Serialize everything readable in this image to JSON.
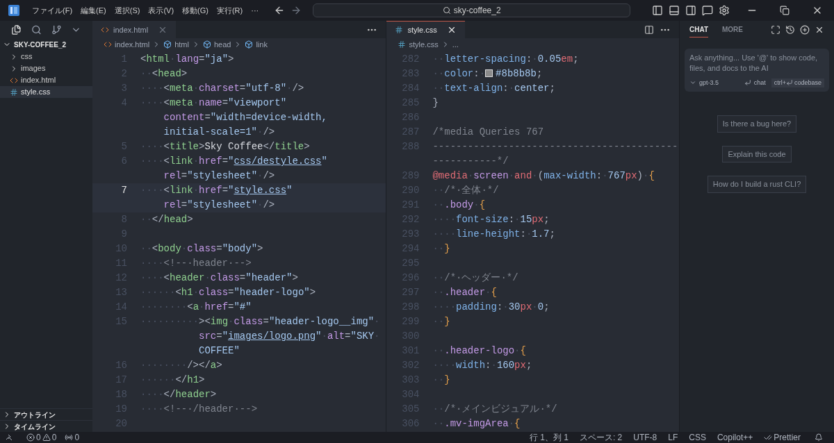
{
  "menu": [
    "ファイル(F)",
    "編集(E)",
    "選択(S)",
    "表示(V)",
    "移動(G)",
    "実行(R)",
    "···"
  ],
  "search": {
    "value": "sky-coffee_2"
  },
  "explorer": {
    "title": "SKY-COFFEE_2",
    "expanded": true,
    "items": [
      {
        "label": "css",
        "kind": "folder",
        "expanded": false,
        "selected": false
      },
      {
        "label": "images",
        "kind": "folder",
        "expanded": false,
        "selected": false
      },
      {
        "label": "index.html",
        "kind": "html",
        "selected": false
      },
      {
        "label": "style.css",
        "kind": "css",
        "selected": true
      }
    ],
    "sections": [
      {
        "label": "アウトライン",
        "expanded": false
      },
      {
        "label": "タイムライン",
        "expanded": false
      }
    ]
  },
  "editors": [
    {
      "focused": false,
      "tab": {
        "label": "index.html",
        "kind": "html"
      },
      "breadcrumb": [
        {
          "kind": "html",
          "text": "index.html"
        },
        {
          "kind": "symbol",
          "text": "html"
        },
        {
          "kind": "symbol",
          "text": "head"
        },
        {
          "kind": "symbol",
          "text": "link"
        }
      ],
      "lines": [
        {
          "number": "1",
          "tokens": [
            {
              "kind": "p",
              "text": "<"
            },
            {
              "kind": "tag",
              "text": "html"
            },
            {
              "kind": "ws",
              "text": "·"
            },
            {
              "kind": "attr",
              "text": "lang"
            },
            {
              "kind": "p",
              "text": "="
            },
            {
              "kind": "str",
              "text": "\"ja\""
            },
            {
              "kind": "p",
              "text": ">"
            }
          ]
        },
        {
          "number": "2",
          "tokens": [
            {
              "kind": "ws",
              "text": "··"
            },
            {
              "kind": "p",
              "text": "<"
            },
            {
              "kind": "tag",
              "text": "head"
            },
            {
              "kind": "p",
              "text": ">"
            }
          ]
        },
        {
          "number": "3",
          "tokens": [
            {
              "kind": "ws",
              "text": "····"
            },
            {
              "kind": "p",
              "text": "<"
            },
            {
              "kind": "tag",
              "text": "meta"
            },
            {
              "kind": "ws",
              "text": "·"
            },
            {
              "kind": "attr",
              "text": "charset"
            },
            {
              "kind": "p",
              "text": "="
            },
            {
              "kind": "str",
              "text": "\"utf-8\""
            },
            {
              "kind": "ws",
              "text": "·"
            },
            {
              "kind": "p",
              "text": "/>"
            }
          ]
        },
        {
          "number": "4",
          "tokens": [
            {
              "kind": "ws",
              "text": "····"
            },
            {
              "kind": "p",
              "text": "<"
            },
            {
              "kind": "tag",
              "text": "meta"
            },
            {
              "kind": "ws",
              "text": "·"
            },
            {
              "kind": "attr",
              "text": "name"
            },
            {
              "kind": "p",
              "text": "="
            },
            {
              "kind": "str",
              "text": "\"viewport\""
            }
          ],
          "wrapped": [
            [
              {
                "kind": "attr",
                "text": "content"
              },
              {
                "kind": "p",
                "text": "="
              },
              {
                "kind": "str",
                "text": "\"width=device-width,"
              }
            ],
            [
              {
                "kind": "str",
                "text": "initial-scale=1\""
              },
              {
                "kind": "ws",
                "text": "·"
              },
              {
                "kind": "p",
                "text": "/>"
              }
            ]
          ]
        },
        {
          "number": "5",
          "tokens": [
            {
              "kind": "ws",
              "text": "····"
            },
            {
              "kind": "p",
              "text": "<"
            },
            {
              "kind": "tag",
              "text": "title"
            },
            {
              "kind": "p",
              "text": ">"
            },
            {
              "kind": "text",
              "text": "Sky Coffee"
            },
            {
              "kind": "p",
              "text": "</"
            },
            {
              "kind": "tag",
              "text": "title"
            },
            {
              "kind": "p",
              "text": ">"
            }
          ]
        },
        {
          "number": "6",
          "tokens": [
            {
              "kind": "ws",
              "text": "····"
            },
            {
              "kind": "p",
              "text": "<"
            },
            {
              "kind": "tag",
              "text": "link"
            },
            {
              "kind": "ws",
              "text": "·"
            },
            {
              "kind": "attr",
              "text": "href"
            },
            {
              "kind": "p",
              "text": "="
            },
            {
              "kind": "str",
              "text": "\""
            },
            {
              "kind": "link",
              "text": "css/destyle.css"
            },
            {
              "kind": "str",
              "text": "\""
            }
          ],
          "wrapped": [
            [
              {
                "kind": "attr",
                "text": "rel"
              },
              {
                "kind": "p",
                "text": "="
              },
              {
                "kind": "str",
                "text": "\"stylesheet\""
              },
              {
                "kind": "ws",
                "text": "·"
              },
              {
                "kind": "p",
                "text": "/>"
              }
            ]
          ]
        },
        {
          "number": "7",
          "current": true,
          "tokens": [
            {
              "kind": "ws",
              "text": "····"
            },
            {
              "kind": "p",
              "text": "<"
            },
            {
              "kind": "tag",
              "text": "link"
            },
            {
              "kind": "ws",
              "text": "·"
            },
            {
              "kind": "attr",
              "text": "href"
            },
            {
              "kind": "p",
              "text": "="
            },
            {
              "kind": "str",
              "text": "\""
            },
            {
              "kind": "link",
              "text": "style.css"
            },
            {
              "kind": "str",
              "text": "\""
            }
          ],
          "wrapped": [
            [
              {
                "kind": "attr",
                "text": "rel"
              },
              {
                "kind": "p",
                "text": "="
              },
              {
                "kind": "str",
                "text": "\"stylesheet\""
              },
              {
                "kind": "ws",
                "text": "·"
              },
              {
                "kind": "p",
                "text": "/>"
              }
            ]
          ]
        },
        {
          "number": "8",
          "tokens": [
            {
              "kind": "ws",
              "text": "··"
            },
            {
              "kind": "p",
              "text": "</"
            },
            {
              "kind": "tag",
              "text": "head"
            },
            {
              "kind": "p",
              "text": ">"
            }
          ]
        },
        {
          "number": "9"
        },
        {
          "number": "10",
          "tokens": [
            {
              "kind": "ws",
              "text": "··"
            },
            {
              "kind": "p",
              "text": "<"
            },
            {
              "kind": "tag",
              "text": "body"
            },
            {
              "kind": "ws",
              "text": "·"
            },
            {
              "kind": "attr",
              "text": "class"
            },
            {
              "kind": "p",
              "text": "="
            },
            {
              "kind": "str",
              "text": "\"body\""
            },
            {
              "kind": "p",
              "text": ">"
            }
          ]
        },
        {
          "number": "11",
          "tokens": [
            {
              "kind": "ws",
              "text": "····"
            },
            {
              "kind": "com",
              "text": "<!--·header·-->"
            }
          ]
        },
        {
          "number": "12",
          "tokens": [
            {
              "kind": "ws",
              "text": "····"
            },
            {
              "kind": "p",
              "text": "<"
            },
            {
              "kind": "tag",
              "text": "header"
            },
            {
              "kind": "ws",
              "text": "·"
            },
            {
              "kind": "attr",
              "text": "class"
            },
            {
              "kind": "p",
              "text": "="
            },
            {
              "kind": "str",
              "text": "\"header\""
            },
            {
              "kind": "p",
              "text": ">"
            }
          ]
        },
        {
          "number": "13",
          "tokens": [
            {
              "kind": "ws",
              "text": "······"
            },
            {
              "kind": "p",
              "text": "<"
            },
            {
              "kind": "tag",
              "text": "h1"
            },
            {
              "kind": "ws",
              "text": "·"
            },
            {
              "kind": "attr",
              "text": "class"
            },
            {
              "kind": "p",
              "text": "="
            },
            {
              "kind": "str",
              "text": "\"header-logo\""
            },
            {
              "kind": "p",
              "text": ">"
            }
          ]
        },
        {
          "number": "14",
          "tokens": [
            {
              "kind": "ws",
              "text": "········"
            },
            {
              "kind": "p",
              "text": "<"
            },
            {
              "kind": "tag",
              "text": "a"
            },
            {
              "kind": "ws",
              "text": "·"
            },
            {
              "kind": "attr",
              "text": "href"
            },
            {
              "kind": "p",
              "text": "="
            },
            {
              "kind": "str",
              "text": "\"#\""
            }
          ]
        },
        {
          "number": "15",
          "tokens": [
            {
              "kind": "ws",
              "text": "··········"
            },
            {
              "kind": "p",
              "text": "><"
            },
            {
              "kind": "tag",
              "text": "img"
            },
            {
              "kind": "ws",
              "text": "·"
            },
            {
              "kind": "attr",
              "text": "class"
            },
            {
              "kind": "p",
              "text": "="
            },
            {
              "kind": "str",
              "text": "\"header-logo__img\""
            },
            {
              "kind": "ws",
              "text": "·"
            }
          ],
          "wrapped": [
            [
              {
                "kind": "attr",
                "text": "src"
              },
              {
                "kind": "p",
                "text": "="
              },
              {
                "kind": "str",
                "text": "\""
              },
              {
                "kind": "link",
                "text": "images/logo.png"
              },
              {
                "kind": "str",
                "text": "\""
              },
              {
                "kind": "ws",
                "text": "·"
              },
              {
                "kind": "attr",
                "text": "alt"
              },
              {
                "kind": "p",
                "text": "="
              },
              {
                "kind": "str",
                "text": "\"SKY"
              },
              {
                "kind": "ws",
                "text": "·"
              }
            ],
            [
              {
                "kind": "str",
                "text": "COFFEE\""
              }
            ]
          ]
        },
        {
          "number": "16",
          "tokens": [
            {
              "kind": "ws",
              "text": "········"
            },
            {
              "kind": "p",
              "text": "/></"
            },
            {
              "kind": "tag",
              "text": "a"
            },
            {
              "kind": "p",
              "text": ">"
            }
          ]
        },
        {
          "number": "17",
          "tokens": [
            {
              "kind": "ws",
              "text": "······"
            },
            {
              "kind": "p",
              "text": "</"
            },
            {
              "kind": "tag",
              "text": "h1"
            },
            {
              "kind": "p",
              "text": ">"
            }
          ]
        },
        {
          "number": "18",
          "tokens": [
            {
              "kind": "ws",
              "text": "····"
            },
            {
              "kind": "p",
              "text": "</"
            },
            {
              "kind": "tag",
              "text": "header"
            },
            {
              "kind": "p",
              "text": ">"
            }
          ]
        },
        {
          "number": "19",
          "tokens": [
            {
              "kind": "ws",
              "text": "····"
            },
            {
              "kind": "com",
              "text": "<!--·/header·-->"
            }
          ]
        },
        {
          "number": "20"
        }
      ]
    },
    {
      "focused": true,
      "tab": {
        "label": "style.css",
        "kind": "css"
      },
      "breadcrumb": [
        {
          "kind": "css",
          "text": "style.css"
        },
        {
          "kind": "more",
          "text": "..."
        }
      ],
      "lines": [
        {
          "number": "282",
          "tokens": [
            {
              "kind": "ws",
              "text": "··"
            },
            {
              "kind": "prop",
              "text": "letter-spacing"
            },
            {
              "kind": "p",
              "text": ":"
            },
            {
              "kind": "ws",
              "text": "·"
            },
            {
              "kind": "num",
              "text": "0.05"
            },
            {
              "kind": "unit",
              "text": "em"
            },
            {
              "kind": "p",
              "text": ";"
            }
          ]
        },
        {
          "number": "283",
          "tokens": [
            {
              "kind": "ws",
              "text": "··"
            },
            {
              "kind": "prop",
              "text": "color"
            },
            {
              "kind": "p",
              "text": ":"
            },
            {
              "kind": "ws",
              "text": "·"
            },
            {
              "kind": "swatch",
              "color": "#8b8b8b"
            },
            {
              "kind": "num",
              "text": "#8b8b8b"
            },
            {
              "kind": "p",
              "text": ";"
            }
          ]
        },
        {
          "number": "284",
          "tokens": [
            {
              "kind": "ws",
              "text": "··"
            },
            {
              "kind": "prop",
              "text": "text-align"
            },
            {
              "kind": "p",
              "text": ":"
            },
            {
              "kind": "ws",
              "text": "·"
            },
            {
              "kind": "num",
              "text": "center"
            },
            {
              "kind": "p",
              "text": ";"
            }
          ]
        },
        {
          "number": "285",
          "tokens": [
            {
              "kind": "p",
              "text": "}"
            }
          ]
        },
        {
          "number": "286"
        },
        {
          "number": "287",
          "tokens": [
            {
              "kind": "com",
              "text": "/*media Queries 767"
            }
          ]
        },
        {
          "number": "288",
          "tokens": [
            {
              "kind": "com",
              "text": "------------------------------------------"
            }
          ],
          "wrapped": [
            [
              {
                "kind": "com",
                "text": "-----------*/"
              }
            ]
          ]
        },
        {
          "number": "289",
          "tokens": [
            {
              "kind": "at",
              "text": "@media"
            },
            {
              "kind": "ws",
              "text": "·"
            },
            {
              "kind": "sel",
              "text": "screen"
            },
            {
              "kind": "ws",
              "text": "·"
            },
            {
              "kind": "at",
              "text": "and"
            },
            {
              "kind": "ws",
              "text": "·"
            },
            {
              "kind": "p",
              "text": "("
            },
            {
              "kind": "prop",
              "text": "max-width"
            },
            {
              "kind": "p",
              "text": ":"
            },
            {
              "kind": "ws",
              "text": "·"
            },
            {
              "kind": "num",
              "text": "767"
            },
            {
              "kind": "unit",
              "text": "px"
            },
            {
              "kind": "p",
              "text": ")"
            },
            {
              "kind": "ws",
              "text": "·"
            },
            {
              "kind": "brace",
              "text": "{"
            }
          ]
        },
        {
          "number": "290",
          "tokens": [
            {
              "kind": "ws",
              "text": "··"
            },
            {
              "kind": "com",
              "text": "/*·全体·*/"
            }
          ]
        },
        {
          "number": "291",
          "tokens": [
            {
              "kind": "ws",
              "text": "··"
            },
            {
              "kind": "sel",
              "text": ".body"
            },
            {
              "kind": "ws",
              "text": "·"
            },
            {
              "kind": "brace",
              "text": "{"
            }
          ]
        },
        {
          "number": "292",
          "tokens": [
            {
              "kind": "ws",
              "text": "····"
            },
            {
              "kind": "prop",
              "text": "font-size"
            },
            {
              "kind": "p",
              "text": ":"
            },
            {
              "kind": "ws",
              "text": "·"
            },
            {
              "kind": "num",
              "text": "15"
            },
            {
              "kind": "unit",
              "text": "px"
            },
            {
              "kind": "p",
              "text": ";"
            }
          ]
        },
        {
          "number": "293",
          "tokens": [
            {
              "kind": "ws",
              "text": "····"
            },
            {
              "kind": "prop",
              "text": "line-height"
            },
            {
              "kind": "p",
              "text": ":"
            },
            {
              "kind": "ws",
              "text": "·"
            },
            {
              "kind": "num",
              "text": "1.7"
            },
            {
              "kind": "p",
              "text": ";"
            }
          ]
        },
        {
          "number": "294",
          "tokens": [
            {
              "kind": "ws",
              "text": "··"
            },
            {
              "kind": "brace",
              "text": "}"
            }
          ]
        },
        {
          "number": "295"
        },
        {
          "number": "296",
          "tokens": [
            {
              "kind": "ws",
              "text": "··"
            },
            {
              "kind": "com",
              "text": "/*·ヘッダー·*/"
            }
          ]
        },
        {
          "number": "297",
          "tokens": [
            {
              "kind": "ws",
              "text": "··"
            },
            {
              "kind": "sel",
              "text": ".header"
            },
            {
              "kind": "ws",
              "text": "·"
            },
            {
              "kind": "brace",
              "text": "{"
            }
          ]
        },
        {
          "number": "298",
          "tokens": [
            {
              "kind": "ws",
              "text": "····"
            },
            {
              "kind": "prop",
              "text": "padding"
            },
            {
              "kind": "p",
              "text": ":"
            },
            {
              "kind": "ws",
              "text": "·"
            },
            {
              "kind": "num",
              "text": "30"
            },
            {
              "kind": "unit",
              "text": "px"
            },
            {
              "kind": "ws",
              "text": "·"
            },
            {
              "kind": "num",
              "text": "0"
            },
            {
              "kind": "p",
              "text": ";"
            }
          ]
        },
        {
          "number": "299",
          "tokens": [
            {
              "kind": "ws",
              "text": "··"
            },
            {
              "kind": "brace",
              "text": "}"
            }
          ]
        },
        {
          "number": "300"
        },
        {
          "number": "301",
          "tokens": [
            {
              "kind": "ws",
              "text": "··"
            },
            {
              "kind": "sel",
              "text": ".header-logo"
            },
            {
              "kind": "ws",
              "text": "·"
            },
            {
              "kind": "brace",
              "text": "{"
            }
          ]
        },
        {
          "number": "302",
          "tokens": [
            {
              "kind": "ws",
              "text": "····"
            },
            {
              "kind": "prop",
              "text": "width"
            },
            {
              "kind": "p",
              "text": ":"
            },
            {
              "kind": "ws",
              "text": "·"
            },
            {
              "kind": "num",
              "text": "160"
            },
            {
              "kind": "unit",
              "text": "px"
            },
            {
              "kind": "p",
              "text": ";"
            }
          ]
        },
        {
          "number": "303",
          "tokens": [
            {
              "kind": "ws",
              "text": "··"
            },
            {
              "kind": "brace",
              "text": "}"
            }
          ]
        },
        {
          "number": "304"
        },
        {
          "number": "305",
          "tokens": [
            {
              "kind": "ws",
              "text": "··"
            },
            {
              "kind": "com",
              "text": "/*·メインビジュアル·*/"
            }
          ]
        },
        {
          "number": "306",
          "tokens": [
            {
              "kind": "ws",
              "text": "··"
            },
            {
              "kind": "sel",
              "text": ".mv-imgArea"
            },
            {
              "kind": "ws",
              "text": "·"
            },
            {
              "kind": "brace",
              "text": "{"
            }
          ]
        }
      ]
    }
  ],
  "chat": {
    "tabs": [
      {
        "label": "CHAT",
        "selected": true
      },
      {
        "label": "MORE",
        "selected": false
      }
    ],
    "input": {
      "placeholder": "Ask anything... Use '@' to show code, files, and docs to the AI"
    },
    "model": "gpt-3.5",
    "send_hint": "chat",
    "codebase_hint": {
      "prefix": "ctrl+",
      "label": "codebase"
    },
    "suggestions": [
      "Is there a bug here?",
      "Explain this code",
      "How do I build a rust CLI?"
    ]
  },
  "status_bar": {
    "errors": "0",
    "warnings": "0",
    "ports": "0",
    "items": [
      {
        "kind": "plain",
        "text": "行 1、列 1"
      },
      {
        "kind": "plain",
        "text": "スペース: 2"
      },
      {
        "kind": "plain",
        "text": "UTF-8"
      },
      {
        "kind": "plain",
        "text": "LF"
      },
      {
        "kind": "plain",
        "text": "CSS"
      },
      {
        "kind": "plain",
        "text": "Copilot++"
      },
      {
        "kind": "prettier",
        "text": "Prettier"
      }
    ]
  }
}
